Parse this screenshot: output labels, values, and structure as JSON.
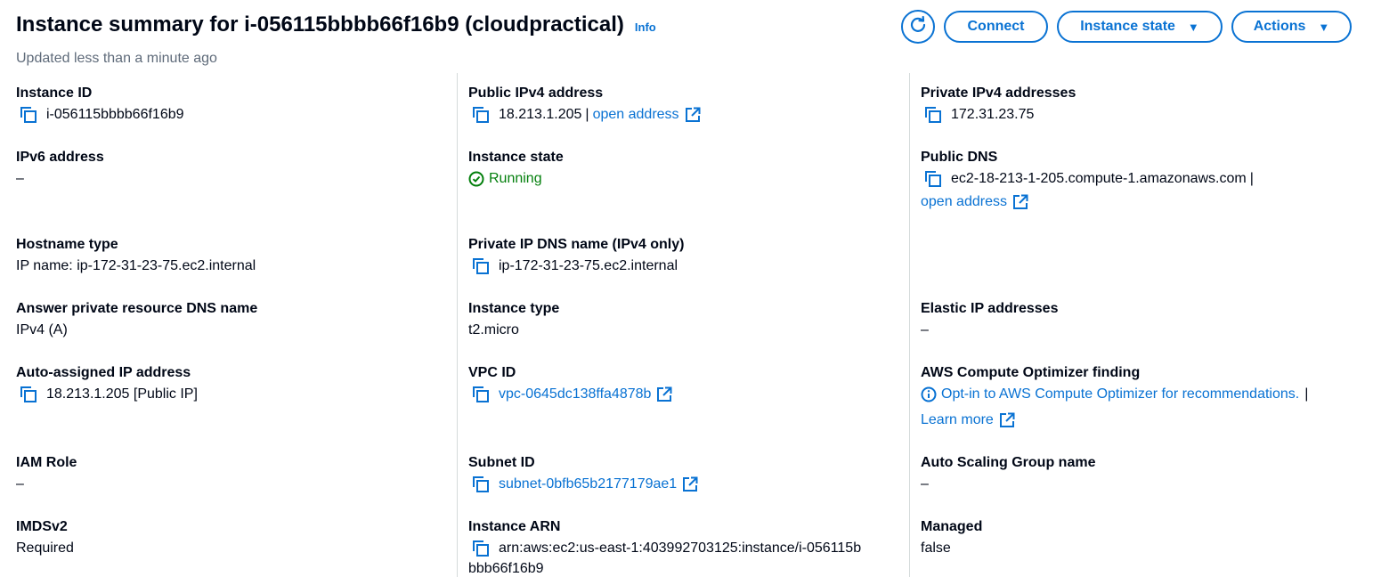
{
  "header": {
    "title": "Instance summary for i-056115bbbb66f16b9 (cloudpractical)",
    "info": "Info",
    "subtitle": "Updated less than a minute ago"
  },
  "buttons": {
    "connect": "Connect",
    "instance_state": "Instance state",
    "actions": "Actions"
  },
  "fields": {
    "instance_id": {
      "label": "Instance ID",
      "value": "i-056115bbbb66f16b9"
    },
    "ipv6": {
      "label": "IPv6 address",
      "value": "–"
    },
    "hostname_type": {
      "label": "Hostname type",
      "value": "IP name: ip-172-31-23-75.ec2.internal"
    },
    "answer_dns": {
      "label": "Answer private resource DNS name",
      "value": "IPv4 (A)"
    },
    "auto_ip": {
      "label": "Auto-assigned IP address",
      "value": "18.213.1.205 [Public IP]"
    },
    "iam_role": {
      "label": "IAM Role",
      "value": "–"
    },
    "imdsv2": {
      "label": "IMDSv2",
      "value": "Required"
    },
    "public_ipv4": {
      "label": "Public IPv4 address",
      "value": "18.213.1.205",
      "sep": "|",
      "link": "open address"
    },
    "instance_state": {
      "label": "Instance state",
      "value": "Running"
    },
    "private_dns": {
      "label": "Private IP DNS name (IPv4 only)",
      "value": "ip-172-31-23-75.ec2.internal"
    },
    "instance_type": {
      "label": "Instance type",
      "value": "t2.micro"
    },
    "vpc_id": {
      "label": "VPC ID",
      "value": "vpc-0645dc138ffa4878b"
    },
    "subnet_id": {
      "label": "Subnet ID",
      "value": "subnet-0bfb65b2177179ae1"
    },
    "instance_arn": {
      "label": "Instance ARN",
      "value_line1": "arn:aws:ec2:us-east-1:403992703125:instance/i-056115b",
      "value_line2": "bbb66f16b9"
    },
    "private_ipv4": {
      "label": "Private IPv4 addresses",
      "value": "172.31.23.75"
    },
    "public_dns": {
      "label": "Public DNS",
      "value": "ec2-18-213-1-205.compute-1.amazonaws.com",
      "sep": "|",
      "link": "open address"
    },
    "elastic_ip": {
      "label": "Elastic IP addresses",
      "value": "–"
    },
    "optimizer": {
      "label": "AWS Compute Optimizer finding",
      "link": "Opt-in to AWS Compute Optimizer for recommendations.",
      "sep": "|",
      "learn_more": "Learn more"
    },
    "asg": {
      "label": "Auto Scaling Group name",
      "value": "–"
    },
    "managed": {
      "label": "Managed",
      "value": "false"
    }
  },
  "icons": {
    "copy": "copy-icon",
    "external": "external-link-icon",
    "refresh": "refresh-icon",
    "caret": "caret-down-icon",
    "running": "check-circle-icon",
    "info": "info-circle-icon"
  },
  "colors": {
    "link": "#0972d3",
    "running": "#037f0c",
    "text": "#000716",
    "muted": "#5f6b7a",
    "divider": "#d5dbdb"
  }
}
